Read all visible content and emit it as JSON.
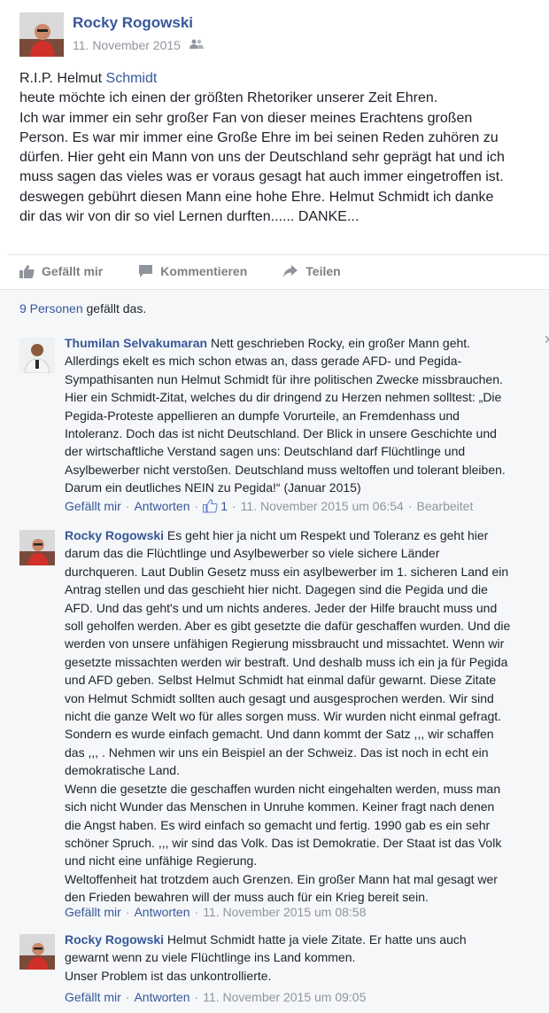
{
  "post": {
    "author": "Rocky Rogowski",
    "date": "11. November 2015",
    "audience_icon": "friends-icon",
    "title_prefix": "R.I.P. Helmut ",
    "title_link": "Schmidt",
    "lines": [
      "heute möchte ich einen der größten Rhetoriker unserer Zeit Ehren.",
      "Ich war immer ein sehr großer Fan von dieser meines Erachtens großen",
      "Person. Es war mir immer eine Große Ehre im bei seinen Reden zuhören zu",
      "dürfen. Hier geht ein Mann von uns der Deutschland sehr geprägt hat und ich",
      "muss sagen das vieles was er voraus gesagt hat auch immer eingetroffen ist.",
      "deswegen gebührt diesen Mann eine hohe Ehre. Helmut Schmidt ich danke",
      "dir das wir von dir so viel Lernen durften...... DANKE..."
    ]
  },
  "actions": {
    "like": "Gefällt mir",
    "comment": "Kommentieren",
    "share": "Teilen"
  },
  "likes": {
    "people_link": "9 Personen",
    "suffix": " gefällt das."
  },
  "comments": [
    {
      "name": "Thumilan Selvakumaran",
      "first_line": " Nett geschrieben Rocky, ein großer Mann geht.",
      "lines": [
        "Allerdings ekelt es mich schon etwas an, dass gerade AFD- und Pegida-",
        "Sympathisanten nun Helmut Schmidt für ihre politischen Zwecke missbrauchen.",
        "Hier ein Schmidt-Zitat, welches du dir dringend zu Herzen nehmen solltest: „Die",
        "Pegida-Proteste appellieren an dumpfe Vorurteile, an Fremdenhass und",
        "Intoleranz. Doch das ist nicht Deutschland. Der Blick in unsere Geschichte und",
        "der wirtschaftliche Verstand sagen uns: Deutschland darf Flüchtlinge und",
        "Asylbewerber nicht verstoßen. Deutschland muss weltoffen und tolerant bleiben.",
        "Darum ein deutliches NEIN zu Pegida!“ (Januar 2015)"
      ],
      "like_label": "Gefällt mir",
      "reply_label": "Antworten",
      "like_count": "1",
      "timestamp": "11. November 2015 um 06:54",
      "edited": "Bearbeitet"
    },
    {
      "name": "Rocky Rogowski",
      "first_line": " Es geht hier ja nicht um Respekt und Toleranz es geht hier",
      "lines": [
        "darum das die Flüchtlinge und Asylbewerber so viele sichere Länder",
        "durchqueren. Laut Dublin Gesetz muss ein asylbewerber im 1. sicheren Land ein",
        "Antrag stellen und das geschieht hier nicht. Dagegen sind die Pegida und die",
        "AFD. Und das geht's und um nichts anderes. Jeder der Hilfe braucht muss und",
        "soll geholfen werden. Aber es gibt gesetzte die dafür geschaffen wurden. Und die",
        "werden von unsere unfähigen Regierung missbraucht und missachtet. Wenn wir",
        "gesetzte missachten werden wir bestraft. Und deshalb muss ich ein ja für Pegida",
        "und AFD geben. Selbst Helmut Schmidt hat einmal dafür gewarnt. Diese Zitate",
        "von Helmut Schmidt sollten auch gesagt und ausgesprochen werden. Wir sind",
        "nicht die ganze Welt wo für alles sorgen muss. Wir wurden nicht einmal gefragt.",
        "Sondern es wurde einfach gemacht. Und dann kommt der Satz ,,, wir schaffen",
        "das ,,, . Nehmen wir uns ein Beispiel an der Schweiz. Das ist noch in echt ein",
        "demokratische Land.",
        "Wenn die gesetzte die geschaffen wurden nicht eingehalten werden, muss man",
        "sich nicht Wunder das Menschen in Unruhe kommen. Keiner fragt nach denen",
        "die Angst haben. Es wird einfach so gemacht und fertig. 1990 gab es ein sehr",
        "schöner Spruch. ,,, wir sind das Volk. Das ist Demokratie. Der Staat ist das Volk",
        "und nicht eine unfähige Regierung.",
        "Weltoffenheit hat trotzdem auch Grenzen. Ein großer Mann hat mal gesagt wer",
        "den Frieden bewahren will der muss auch für ein Krieg bereit sein."
      ],
      "like_label": "Gefällt mir",
      "reply_label": "Antworten",
      "timestamp": "11. November 2015 um 08:58"
    },
    {
      "name": "Rocky Rogowski",
      "first_line": " Helmut Schmidt hatte ja viele Zitate. Er hatte uns auch",
      "lines": [
        "gewarnt wenn zu viele Flüchtlinge ins Land kommen.",
        "Unser Problem ist das unkontrollierte."
      ],
      "like_label": "Gefällt mir",
      "reply_label": "Antworten",
      "timestamp": "11. November 2015 um 09:05"
    }
  ],
  "colors": {
    "link": "#365899",
    "meta": "#90949c",
    "text": "#1d2129",
    "comment_bg": "#f6f7f9"
  }
}
